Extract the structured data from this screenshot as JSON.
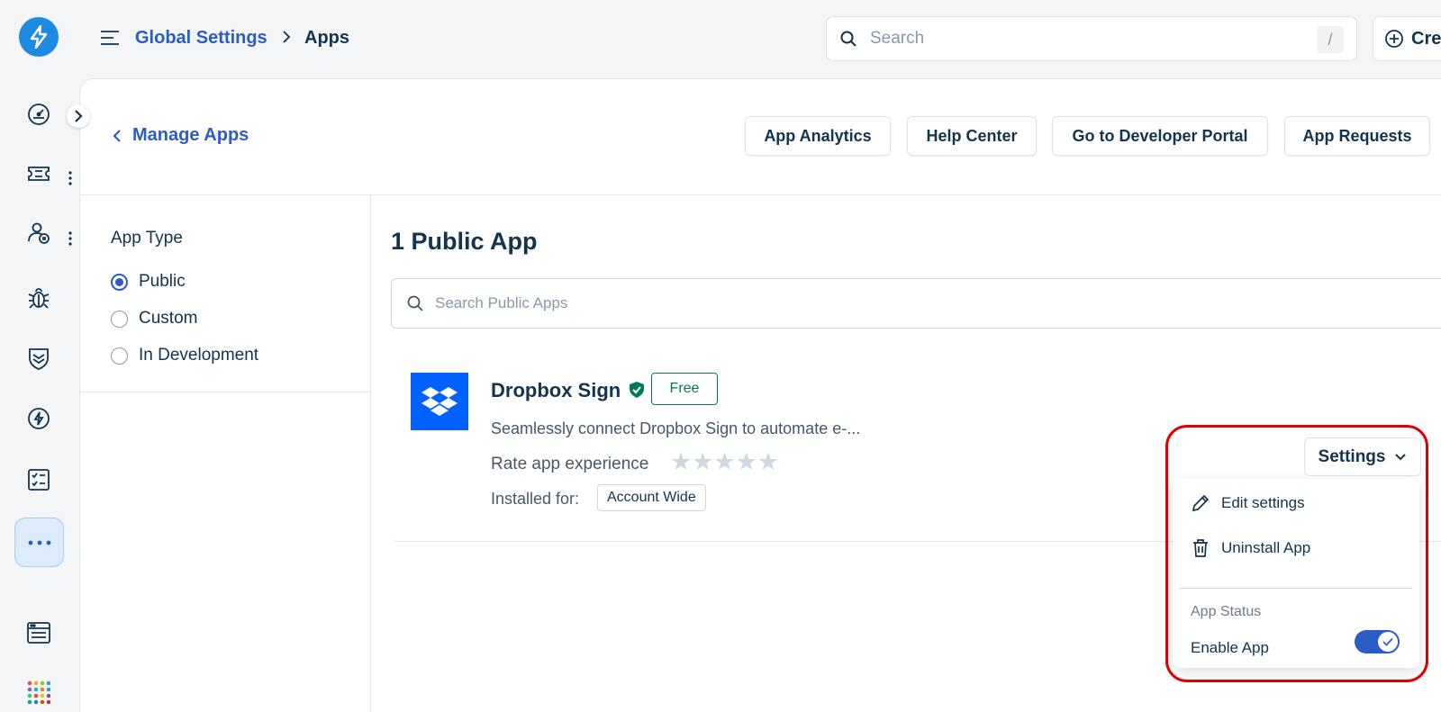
{
  "header": {
    "breadcrumb_parent": "Global Settings",
    "breadcrumb_current": "Apps",
    "search_placeholder": "Search",
    "search_shortcut": "/",
    "create_label": "Create"
  },
  "sidebar": {
    "icons": [
      "dashboard-icon",
      "tickets-icon",
      "contacts-icon",
      "problems-icon",
      "changes-icon",
      "releases-icon",
      "tasks-icon",
      "more-icon",
      "announcements-icon",
      "app-switcher-icon"
    ]
  },
  "page": {
    "back_label": "Manage Apps",
    "actions": [
      "App Analytics",
      "Help Center",
      "Go to Developer Portal",
      "App Requests"
    ]
  },
  "filters": {
    "title": "App Type",
    "options": [
      {
        "label": "Public",
        "checked": true
      },
      {
        "label": "Custom",
        "checked": false
      },
      {
        "label": "In Development",
        "checked": false
      }
    ]
  },
  "results": {
    "title": "1 Public App",
    "search_placeholder": "Search Public Apps"
  },
  "app": {
    "name": "Dropbox Sign",
    "badge": "Free",
    "description": "Seamlessly connect Dropbox Sign to automate e-...",
    "rate_label": "Rate app experience",
    "rating": 0,
    "stars": "★★★★★",
    "installed_label": "Installed for:",
    "installed_scope": "Account Wide"
  },
  "settings_menu": {
    "button_label": "Settings",
    "edit_label": "Edit settings",
    "uninstall_label": "Uninstall App",
    "status_section": "App Status",
    "enable_label": "Enable App",
    "enabled": true
  },
  "colors": {
    "accent": "#2c5cc5",
    "brand": "#1e8be0",
    "dropbox": "#0061fe",
    "success": "#00795b",
    "highlight": "#e00000"
  }
}
